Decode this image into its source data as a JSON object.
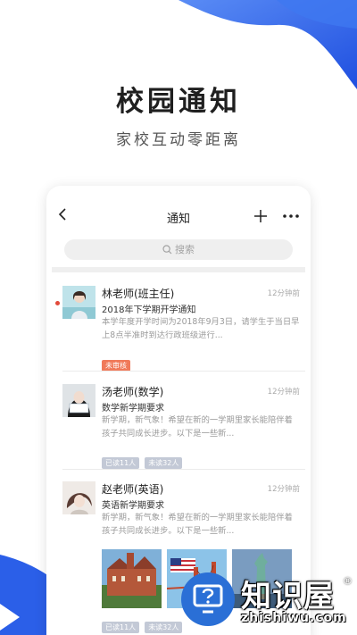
{
  "colors": {
    "accent": "#2f63ee",
    "unread": "#e24a3b",
    "tag_red": "#f07a5a",
    "tag_grey": "#c3c9d6"
  },
  "hero": {
    "title": "校园通知",
    "subtitle": "家校互动零距离"
  },
  "navbar": {
    "title": "通知",
    "back_icon": "chevron-left-icon",
    "add_icon": "plus-icon",
    "more_icon": "more-icon"
  },
  "search": {
    "placeholder": "搜索",
    "icon": "search-icon"
  },
  "messages": [
    {
      "name": "林老师(班主任)",
      "time": "12分钟前",
      "subject": "2018年下学期开学通知",
      "body": "本学年度开学时间为2018年9月3日，请学生于当日早上8点半准时到达行政班级进行...",
      "tags": [
        "未审核"
      ],
      "unread": true
    },
    {
      "name": "汤老师(数学)",
      "time": "12分钟前",
      "subject": "数学新学期要求",
      "body": "新学期，新气象！希望在新的一学期里家长能陪伴着孩子共同成长进步。以下是一些新...",
      "tags": [
        "已读11人",
        "未读32人"
      ],
      "unread": false
    },
    {
      "name": "赵老师(英语)",
      "time": "12分钟前",
      "subject": "英语新学期要求",
      "body": "新学期，新气象！希望在新的一学期里家长能陪伴着孩子共同成长进步。以下是一些新...",
      "tags": [
        "已读11人",
        "未读32人"
      ],
      "unread": false
    }
  ],
  "watermark": {
    "text": "知识屋",
    "reg": "®",
    "url": "zhishiwu.com"
  }
}
